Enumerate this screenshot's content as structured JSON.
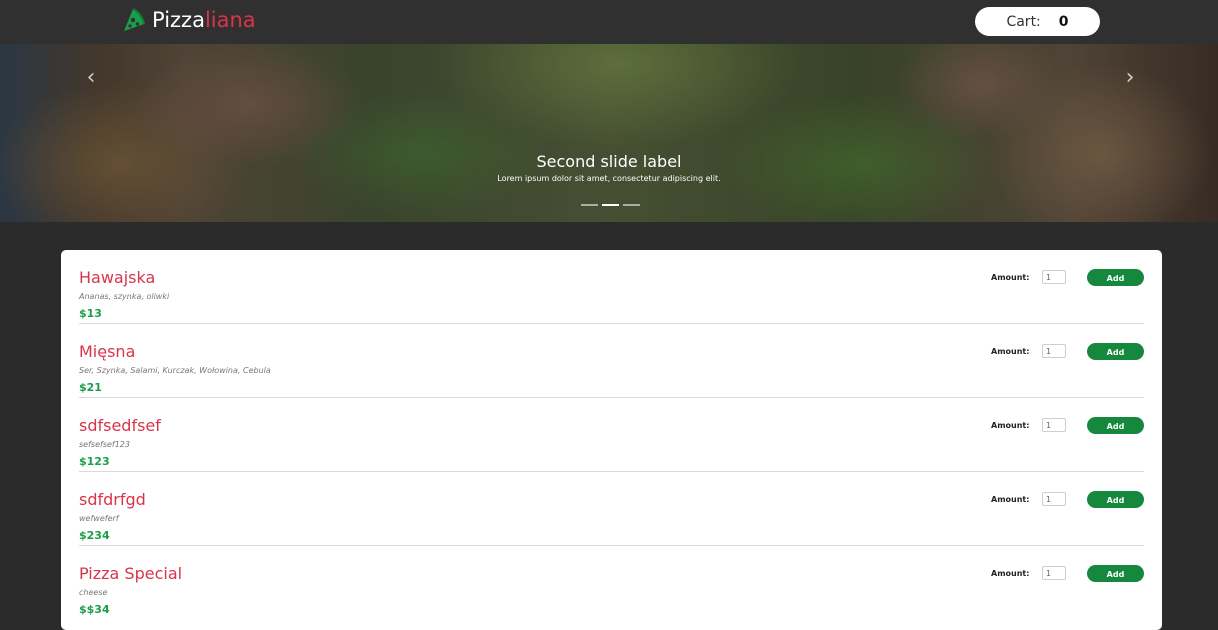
{
  "header": {
    "brand_part1": "Pizza",
    "brand_part2": "liana",
    "brand_icon": "pizza-slice-icon",
    "cart_label": "Cart:",
    "cart_count": "0"
  },
  "carousel": {
    "slide_title": "Second slide label",
    "slide_text": "Lorem ipsum dolor sit amet, consectetur adipiscing elit.",
    "prev_icon": "chevron-left-icon",
    "next_icon": "chevron-right-icon",
    "indicators": 3,
    "active_indicator": 2
  },
  "menu": {
    "amount_label": "Amount:",
    "add_label": "Add",
    "items": [
      {
        "name": "Hawajska",
        "description": "Ananas, szynka, oliwki",
        "price": "$13",
        "amount": "1"
      },
      {
        "name": "Mięsna",
        "description": "Ser, Szynka, Salami, Kurczak, Wołowina, Cebula",
        "price": "$21",
        "amount": "1"
      },
      {
        "name": "sdfsedfsef",
        "description": "sefsefsef123",
        "price": "$123",
        "amount": "1"
      },
      {
        "name": "sdfdrfgd",
        "description": "wefweferf",
        "price": "$234",
        "amount": "1"
      },
      {
        "name": "Pizza Special",
        "description": "cheese",
        "price": "$$34",
        "amount": "1"
      }
    ]
  },
  "colors": {
    "background": "#2b2b2b",
    "navbar": "#303030",
    "accent_red": "#d9344a",
    "price_green": "#1a9e4a",
    "button_green": "#15883e"
  }
}
